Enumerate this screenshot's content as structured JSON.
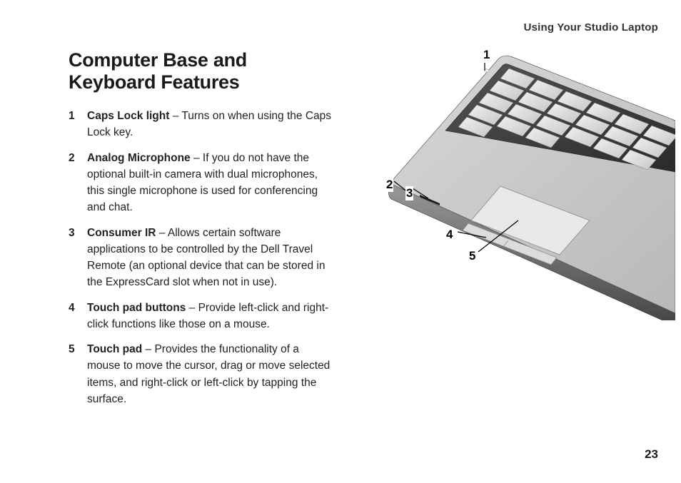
{
  "running_head": "Using Your Studio Laptop",
  "section_title": "Computer Base and Keyboard Features",
  "items": [
    {
      "num": "1",
      "title": "Caps Lock light",
      "sep": " – ",
      "desc": "Turns on when using the Caps Lock key."
    },
    {
      "num": "2",
      "title": "Analog Microphone",
      "sep": " – ",
      "desc": "If you do not have the optional built-in camera with dual microphones, this single microphone is used for conferencing and chat."
    },
    {
      "num": "3",
      "title": "Consumer IR",
      "sep": " – ",
      "desc": "Allows certain software applications to be controlled by the Dell Travel Remote (an optional device that can be stored in the ExpressCard slot when not in use)."
    },
    {
      "num": "4",
      "title": "Touch pad buttons",
      "sep": " – ",
      "desc": "Provide left-click and right-click functions like those on a mouse."
    },
    {
      "num": "5",
      "title": "Touch pad",
      "sep": " – ",
      "desc": "Provides the functionality of a mouse to move the cursor, drag or move selected items, and right-click or left-click by tapping the surface."
    }
  ],
  "callouts": {
    "c1": "1",
    "c2": "2",
    "c3": "3",
    "c4": "4",
    "c5": "5"
  },
  "page_number": "23"
}
